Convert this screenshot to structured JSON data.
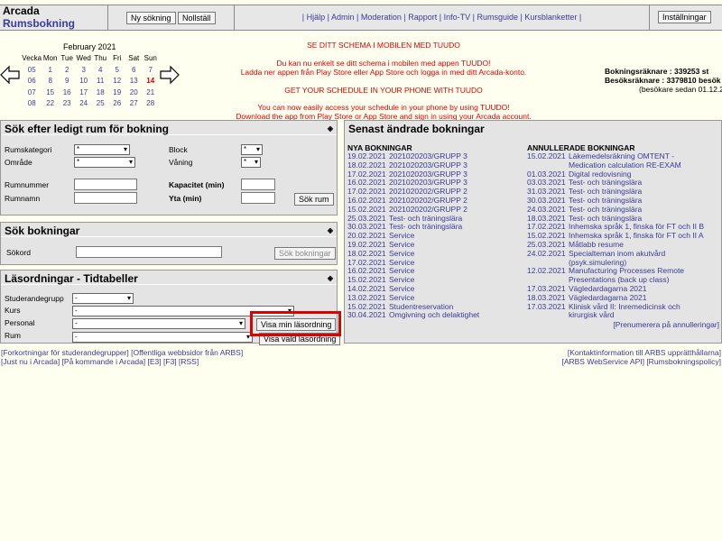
{
  "app": {
    "line1": "Arcada",
    "line2": "Rumsbokning"
  },
  "toolbar": {
    "new_search": "Ny sökning",
    "reset": "Nollställ",
    "settings": "Inställningar"
  },
  "nav": {
    "links": [
      "Hjälp",
      "Admin",
      "Moderation",
      "Rapport",
      "Info-TV",
      "Rumsguide",
      "Kursblanketter"
    ]
  },
  "calendar": {
    "title": "February 2021",
    "headers": [
      "Vecka",
      "Mon",
      "Tue",
      "Wed",
      "Thu",
      "Fri",
      "Sat",
      "Sun"
    ],
    "weeks": [
      {
        "wk": "05",
        "days": [
          "1",
          "2",
          "3",
          "4",
          "5",
          "6",
          "7"
        ]
      },
      {
        "wk": "06",
        "days": [
          "8",
          "9",
          "10",
          "11",
          "12",
          "13",
          "14"
        ]
      },
      {
        "wk": "07",
        "days": [
          "15",
          "16",
          "17",
          "18",
          "19",
          "20",
          "21"
        ]
      },
      {
        "wk": "08",
        "days": [
          "22",
          "23",
          "24",
          "25",
          "26",
          "27",
          "28"
        ]
      }
    ],
    "today": "14"
  },
  "notice": {
    "l1": "SE DITT SCHEMA I MOBILEN MED TUUDO",
    "l2": "Du kan nu enkelt se ditt schema i mobilen med appen TUUDO!",
    "l3": "Ladda ner appen från Play Store eller App Store och logga in med ditt Arcada-konto.",
    "l4": "GET YOUR SCHEDULE IN YOUR PHONE WITH TUUDO",
    "l5": "You can now easily access your schedule in your phone by using TUUDO!",
    "l6": "Download the app from Play Store or App Store and sign in using your Arcada account."
  },
  "stats": {
    "bookings": "Bokningsräknare : 339253 st",
    "visitors": "Besöksräknare : 3379810 besök",
    "since": "(besökare sedan 01.12.2004)"
  },
  "free_room": {
    "title": "Sök efter ledigt rum för bokning",
    "category_label": "Rumskategori",
    "category_value": "*",
    "area_label": "Område",
    "area_value": "*",
    "block_label": "Block",
    "block_value": "*",
    "floor_label": "Våning",
    "floor_value": "*",
    "roomnum_label": "Rumnummer",
    "roomname_label": "Rumnamn",
    "capacity_label": "Kapacitet (min)",
    "size_label": "Yta (min)",
    "search_btn": "Sök rum"
  },
  "search_bookings": {
    "title": "Sök bokningar",
    "word_label": "Sökord",
    "btn": "Sök bokningar"
  },
  "schedules": {
    "title": "Läsordningar - Tidtabeller",
    "group_label": "Studerandegrupp",
    "group_value": "-",
    "course_label": "Kurs",
    "course_value": "-",
    "person_label": "Personal",
    "person_value": "-",
    "room_label": "Rum",
    "room_value": "-",
    "my_btn": "Visa min läsordning",
    "sel_btn": "Visa vald läsordning"
  },
  "recent": {
    "title": "Senast ändrade bokningar",
    "new_title": "NYA BOKNINGAR",
    "cancel_title": "ANNULLERADE BOKNINGAR",
    "new_items": [
      {
        "d": "19.02.2021",
        "t": "2021020203/GRUPP 3"
      },
      {
        "d": "18.02.2021",
        "t": "2021020203/GRUPP 3"
      },
      {
        "d": "17.02.2021",
        "t": "2021020203/GRUPP 3"
      },
      {
        "d": "16.02.2021",
        "t": "2021020203/GRUPP 3"
      },
      {
        "d": "17.02.2021",
        "t": "2021020202/GRUPP 2"
      },
      {
        "d": "16.02.2021",
        "t": "2021020202/GRUPP 2"
      },
      {
        "d": "15.02.2021",
        "t": "2021020202/GRUPP 2"
      },
      {
        "d": "25.03.2021",
        "t": "Test- och träningslära"
      },
      {
        "d": "30.03.2021",
        "t": "Test- och träningslära"
      },
      {
        "d": "20.02.2021",
        "t": "Service"
      },
      {
        "d": "19.02.2021",
        "t": "Service"
      },
      {
        "d": "18.02.2021",
        "t": "Service"
      },
      {
        "d": "17.02.2021",
        "t": "Service"
      },
      {
        "d": "16.02.2021",
        "t": "Service"
      },
      {
        "d": "15.02.2021",
        "t": "Service"
      },
      {
        "d": "14.02.2021",
        "t": "Service"
      },
      {
        "d": "13.02.2021",
        "t": "Service"
      },
      {
        "d": "15.02.2021",
        "t": "Studentreservation"
      },
      {
        "d": "30.04.2021",
        "t": "Omgivning och delaktighet"
      }
    ],
    "cancel_items": [
      {
        "d": "15.02.2021",
        "t": "Läkemedelsräkning OMTENT -"
      },
      {
        "d": "",
        "t": "Medication calculation RE-EXAM"
      },
      {
        "d": "01.03.2021",
        "t": "Digital redovisning"
      },
      {
        "d": "03.03.2021",
        "t": "Test- och träningslära"
      },
      {
        "d": "31.03.2021",
        "t": "Test- och träningslära"
      },
      {
        "d": "30.03.2021",
        "t": "Test- och träningslära"
      },
      {
        "d": "24.03.2021",
        "t": "Test- och träningslära"
      },
      {
        "d": "18.03.2021",
        "t": "Test- och träningslära"
      },
      {
        "d": "17.02.2021",
        "t": "Inhemska språk 1, finska för FT och II B"
      },
      {
        "d": "15.02.2021",
        "t": "Inhemska språk 1, finska för FT och II A"
      },
      {
        "d": "25.03.2021",
        "t": "Måtlabb resume"
      },
      {
        "d": "24.02.2021",
        "t": "Specialteman inom akutvård"
      },
      {
        "d": "",
        "t": "(psyk.simulering)"
      },
      {
        "d": "12.02.2021",
        "t": "Manufacturing Processes Remote"
      },
      {
        "d": "",
        "t": "Presentations (back up class)"
      },
      {
        "d": "17.03.2021",
        "t": "Vägledardagarna 2021"
      },
      {
        "d": "18.03.2021",
        "t": "Vägledardagarna 2021"
      },
      {
        "d": "17.03.2021",
        "t": "Klinisk vård II: Inremedicinsk och"
      },
      {
        "d": "",
        "t": "kirurgisk vård"
      }
    ],
    "subscribe": "[Prenumerera på annulleringar]"
  },
  "footer": {
    "l1": "[Forkortningar för studerandegrupper] [Offentliga webbsidor från ARBS]",
    "l2": "[Just nu i Arcada] [På kommande i Arcada] [E3] [F3] [RSS]",
    "r1": "[Kontaktinformation till ARBS upprätthållarna]",
    "r2": "[ARBS WebService API] [Rumsbokningspolicy]"
  },
  "colors": {
    "link": "#3a3a99",
    "notice": "#e00000",
    "panel": "#e4e4e4",
    "highlight": "#e00000"
  }
}
